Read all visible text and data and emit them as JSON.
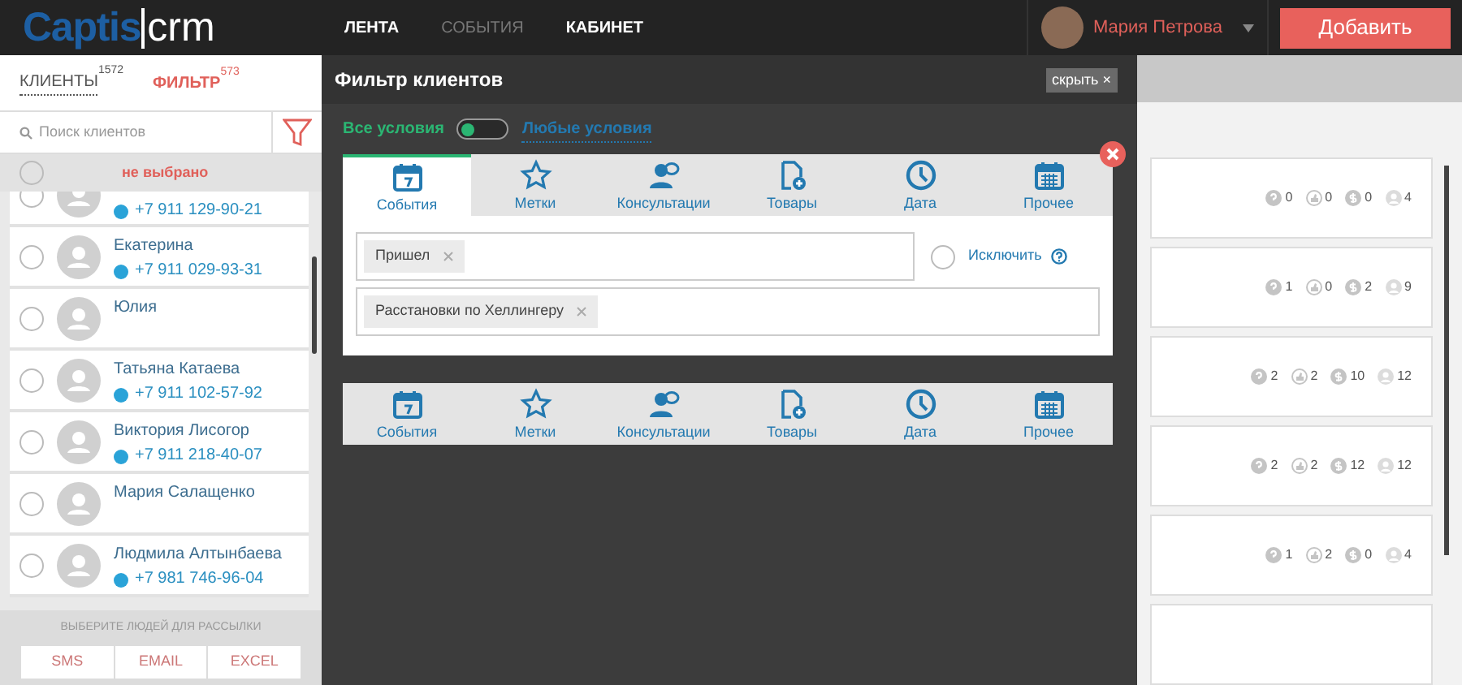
{
  "header": {
    "logo": {
      "brand": "Captis",
      "product": "crm"
    },
    "nav": [
      {
        "label": "ЛЕНТА",
        "dimmed": false
      },
      {
        "label": "СОБЫТИЯ",
        "dimmed": true
      },
      {
        "label": "КАБИНЕТ",
        "dimmed": false
      }
    ],
    "user": {
      "name": "Мария Петрова"
    },
    "add_button": "Добавить"
  },
  "sidebar": {
    "tabs": [
      {
        "label": "КЛИЕНТЫ",
        "count": "1572",
        "selected": false
      },
      {
        "label": "ФИЛЬТР",
        "count": "573",
        "selected": true
      }
    ],
    "search": {
      "placeholder": "Поиск клиентов"
    },
    "select_all": {
      "label": "не выбрано",
      "checked": false
    },
    "clients": [
      {
        "phone": "+7 911 129-90-21",
        "checked": false
      },
      {
        "name": "Екатерина",
        "phone": "+7 911 029-93-31",
        "checked": false
      },
      {
        "name": "Юлия",
        "checked": false
      },
      {
        "name": "Татьяна Катаева",
        "phone": "+7 911 102-57-92",
        "checked": false
      },
      {
        "name": "Виктория Лисогор",
        "phone": "+7 911 218-40-07",
        "checked": false
      },
      {
        "name": "Мария Салащенко",
        "checked": false
      },
      {
        "name": "Людмила Алтынбаева",
        "phone": "+7 981 746-96-04",
        "checked": false
      }
    ],
    "mailing_hint": "ВЫБЕРИТЕ ЛЮДЕЙ ДЛЯ РАССЫЛКИ",
    "export_buttons": [
      "SMS",
      "EMAIL",
      "EXCEL"
    ]
  },
  "filter_panel": {
    "title": "Фильтр клиентов",
    "hide_button": "скрыть ×",
    "match_mode": [
      {
        "label": "Все условия",
        "selected": true
      },
      {
        "label": "Любые условия",
        "selected": false
      }
    ],
    "condition": {
      "tabs": [
        {
          "kind": "events",
          "label": "События",
          "selected": true
        },
        {
          "kind": "tags",
          "label": "Метки",
          "selected": false
        },
        {
          "kind": "consultations",
          "label": "Консультации",
          "selected": false
        },
        {
          "kind": "goods",
          "label": "Товары",
          "selected": false
        },
        {
          "kind": "date",
          "label": "Дата",
          "selected": false
        },
        {
          "kind": "other",
          "label": "Прочее",
          "selected": false
        }
      ],
      "fields": [
        {
          "tags": [
            "Пришел"
          ],
          "exclude": {
            "label": "Исключить",
            "checked": false
          }
        },
        {
          "tags": [
            "Расстановки по Хеллингеру"
          ]
        }
      ]
    },
    "new_condition_tabs": [
      {
        "kind": "events",
        "label": "События"
      },
      {
        "kind": "tags",
        "label": "Метки"
      },
      {
        "kind": "consultations",
        "label": "Консультации"
      },
      {
        "kind": "goods",
        "label": "Товары"
      },
      {
        "kind": "date",
        "label": "Дата"
      },
      {
        "kind": "other",
        "label": "Прочее"
      }
    ]
  },
  "cards": [
    {
      "stats": [
        {
          "kind": "question",
          "value": "0"
        },
        {
          "kind": "like",
          "value": "0"
        },
        {
          "kind": "money",
          "value": "0"
        },
        {
          "kind": "person",
          "value": "4"
        }
      ]
    },
    {
      "stats": [
        {
          "kind": "question",
          "value": "1"
        },
        {
          "kind": "like",
          "value": "0"
        },
        {
          "kind": "money",
          "value": "2"
        },
        {
          "kind": "person",
          "value": "9"
        }
      ]
    },
    {
      "stats": [
        {
          "kind": "question",
          "value": "2"
        },
        {
          "kind": "like",
          "value": "2"
        },
        {
          "kind": "money",
          "value": "10"
        },
        {
          "kind": "person",
          "value": "12"
        }
      ]
    },
    {
      "stats": [
        {
          "kind": "question",
          "value": "2"
        },
        {
          "kind": "like",
          "value": "2"
        },
        {
          "kind": "money",
          "value": "12"
        },
        {
          "kind": "person",
          "value": "12"
        }
      ]
    },
    {
      "stats": [
        {
          "kind": "question",
          "value": "1"
        },
        {
          "kind": "like",
          "value": "2"
        },
        {
          "kind": "money",
          "value": "0"
        },
        {
          "kind": "person",
          "value": "4"
        }
      ]
    }
  ]
}
